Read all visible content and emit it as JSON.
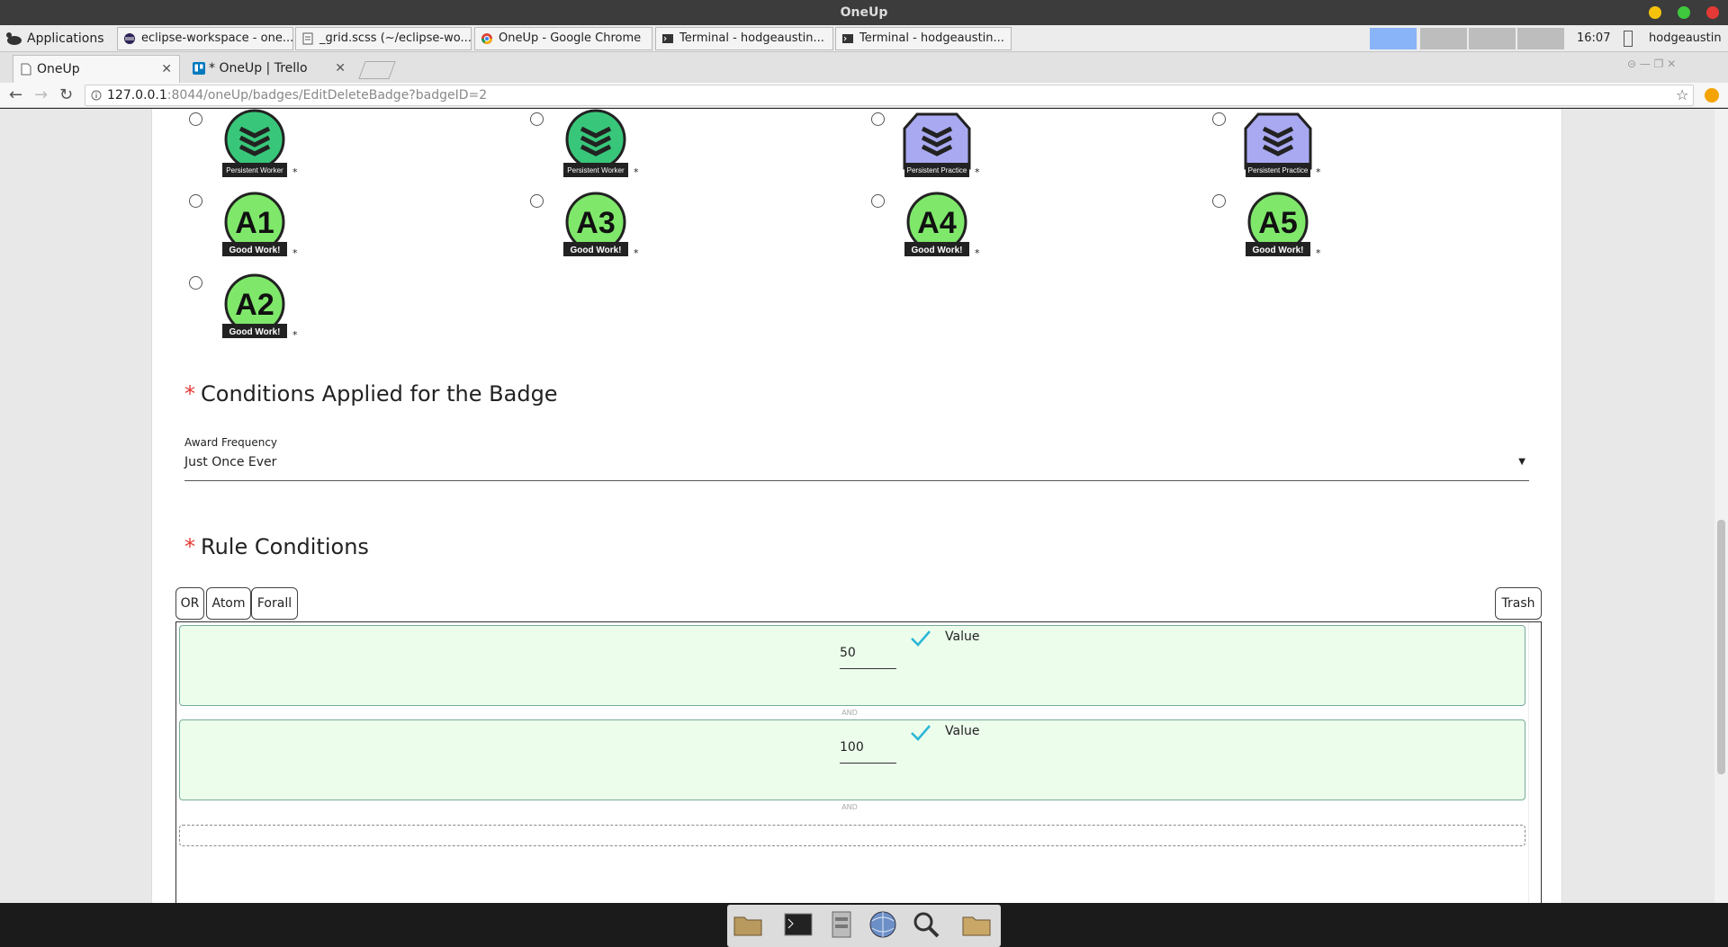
{
  "window": {
    "title": "OneUp"
  },
  "taskbar": {
    "applications_label": "Applications",
    "tasks": [
      {
        "label": "eclipse-workspace - one...",
        "icon": "eclipse-icon"
      },
      {
        "label": "_grid.scss (~/eclipse-wo...",
        "icon": "text-editor-icon"
      },
      {
        "label": "OneUp - Google Chrome",
        "icon": "chrome-icon"
      },
      {
        "label": "Terminal - hodgeaustin...",
        "icon": "terminal-icon"
      },
      {
        "label": "Terminal - hodgeaustin...",
        "icon": "terminal-icon"
      }
    ],
    "clock": "16:07",
    "user": "hodgeaustin"
  },
  "browser": {
    "tabs": [
      {
        "label": "OneUp",
        "active": true
      },
      {
        "label": "* OneUp | Trello",
        "active": false
      }
    ],
    "url_host": "127.0.0.1",
    "url_rest": ":8044/oneUp/badges/EditDeleteBadge?badgeID=2"
  },
  "badges": [
    {
      "name": "Persistent Worker",
      "style": "chevron-green",
      "asterisk": "*"
    },
    {
      "name": "Persistent Worker",
      "style": "chevron-green",
      "asterisk": "*"
    },
    {
      "name": "Persistent Practice",
      "style": "chevron-purple",
      "asterisk": "*"
    },
    {
      "name": "Persistent Practice",
      "style": "chevron-purple",
      "asterisk": "*"
    },
    {
      "name": "A1",
      "caption": "Good Work!",
      "style": "letter-green",
      "asterisk": "*"
    },
    {
      "name": "A3",
      "caption": "Good Work!",
      "style": "letter-green",
      "asterisk": "*"
    },
    {
      "name": "A4",
      "caption": "Good Work!",
      "style": "letter-green",
      "asterisk": "*"
    },
    {
      "name": "A5",
      "caption": "Good Work!",
      "style": "letter-green",
      "asterisk": "*"
    },
    {
      "name": "A2",
      "caption": "Good Work!",
      "style": "letter-green",
      "asterisk": "*"
    }
  ],
  "conditions": {
    "required_marker": "*",
    "title": "Conditions Applied for the Badge",
    "award_frequency_label": "Award Frequency",
    "award_frequency_value": "Just Once Ever"
  },
  "rules": {
    "required_marker": "*",
    "title": "Rule Conditions",
    "blocks": [
      "OR",
      "Atom",
      "Forall"
    ],
    "trash_label": "Trash",
    "items": [
      {
        "value": "50",
        "label": "Value"
      },
      {
        "value": "100",
        "label": "Value"
      }
    ],
    "separator": "AND"
  },
  "colors": {
    "rule_bg": "#ecfdec",
    "check": "#29b6d6",
    "required": "#e53935"
  }
}
